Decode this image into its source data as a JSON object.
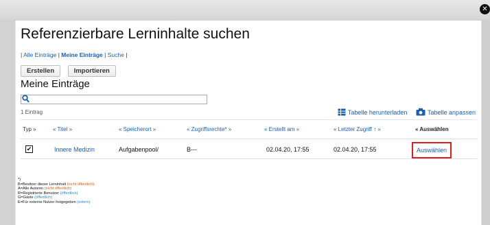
{
  "dialog": {
    "title": "Referenzierbare Lerninhalte suchen",
    "close_symbol": "✕"
  },
  "nav": {
    "items": [
      {
        "label": "Alle Einträge",
        "active": false
      },
      {
        "label": "Meine Einträge",
        "active": true
      },
      {
        "label": "Suche",
        "active": false
      }
    ],
    "separator": "|"
  },
  "buttons": {
    "create": "Erstellen",
    "import": "Importieren"
  },
  "section_title": "Meine Einträge",
  "search": {
    "value": "",
    "placeholder": "",
    "icon": "search-icon"
  },
  "count_text": "1 Eintrag",
  "table_actions": {
    "download": "Tabelle herunterladen",
    "customize": "Tabelle anpassen"
  },
  "table": {
    "headers": {
      "typ": "Typ »",
      "titel": "« Titel »",
      "speicherort": "« Speicherort »",
      "zugriffsrechte": "« Zugriffsrechte* »",
      "erstellt": "« Erstellt am »",
      "letzter_zugriff": "« Letzter Zugriff ↑ »",
      "auswaehlen": "« Auswählen"
    },
    "rows": [
      {
        "checked": "✔",
        "titel": "Innere Medizin",
        "speicherort": "Aufgabenpool/",
        "zugriffsrechte": "B---",
        "erstellt": "02.04.20, 17:55",
        "letzter_zugriff": "02.04.20, 17:55",
        "auswaehlen": "Auswählen"
      }
    ]
  },
  "legend": {
    "marker": "*)",
    "lines": [
      {
        "key": "B",
        "text": "=Besitzer dieser Lerninhalt ",
        "note": "(nicht öffentlich)",
        "color": "orange"
      },
      {
        "key": "A",
        "text": "=Alle Autoren ",
        "note": "(nicht öffentlich)",
        "color": "orange"
      },
      {
        "key": "R",
        "text": "=Registrierte Benutzer ",
        "note": "(öffentlich)",
        "color": "blue"
      },
      {
        "key": "G",
        "text": "=Gäste ",
        "note": "(öffentlich)",
        "color": "blue"
      },
      {
        "key": "E",
        "text": "=Für externe Nutzer freigegeben ",
        "note": "(extern)",
        "color": "blue"
      }
    ]
  },
  "colors": {
    "link": "#1a5fb4",
    "orange": "#e06010",
    "highlight_box": "#e21b1b"
  }
}
